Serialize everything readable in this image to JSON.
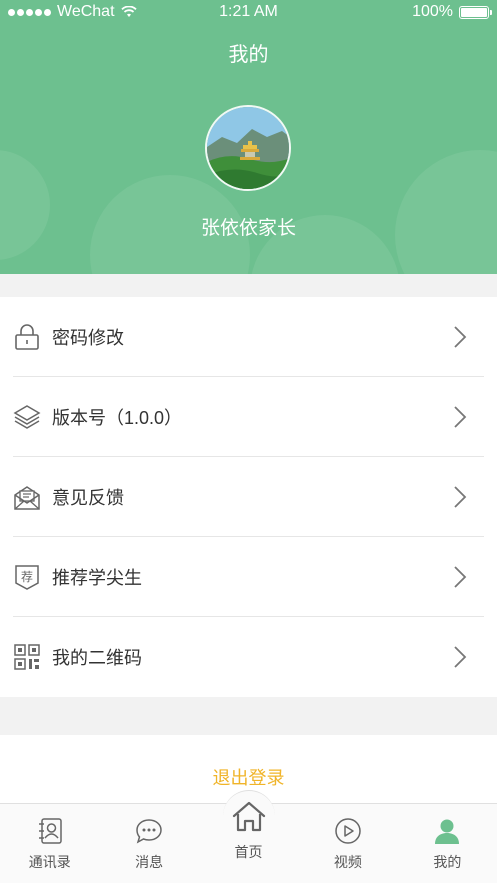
{
  "status_bar": {
    "carrier": "WeChat",
    "time": "1:21 AM",
    "battery": "100%"
  },
  "header": {
    "title": "我的",
    "username": "张依依家长"
  },
  "menu": {
    "items": [
      {
        "label": "密码修改",
        "icon": "lock-icon"
      },
      {
        "label": "版本号（1.0.0）",
        "icon": "layers-icon"
      },
      {
        "label": "意见反馈",
        "icon": "feedback-mail-icon"
      },
      {
        "label": "推荐学尖生",
        "icon": "recommend-badge-icon"
      },
      {
        "label": "我的二维码",
        "icon": "qrcode-icon"
      }
    ]
  },
  "logout": {
    "label": "退出登录"
  },
  "tabbar": {
    "tabs": [
      {
        "label": "通讯录",
        "icon": "contacts-icon"
      },
      {
        "label": "消息",
        "icon": "chat-bubble-icon"
      },
      {
        "label": "首页",
        "icon": "home-icon"
      },
      {
        "label": "视频",
        "icon": "play-circle-icon"
      },
      {
        "label": "我的",
        "icon": "person-icon",
        "active": true
      }
    ]
  },
  "colors": {
    "header_green": "#6dc08f",
    "logout_orange": "#f0b429",
    "active_tab_green": "#6dc08f"
  }
}
